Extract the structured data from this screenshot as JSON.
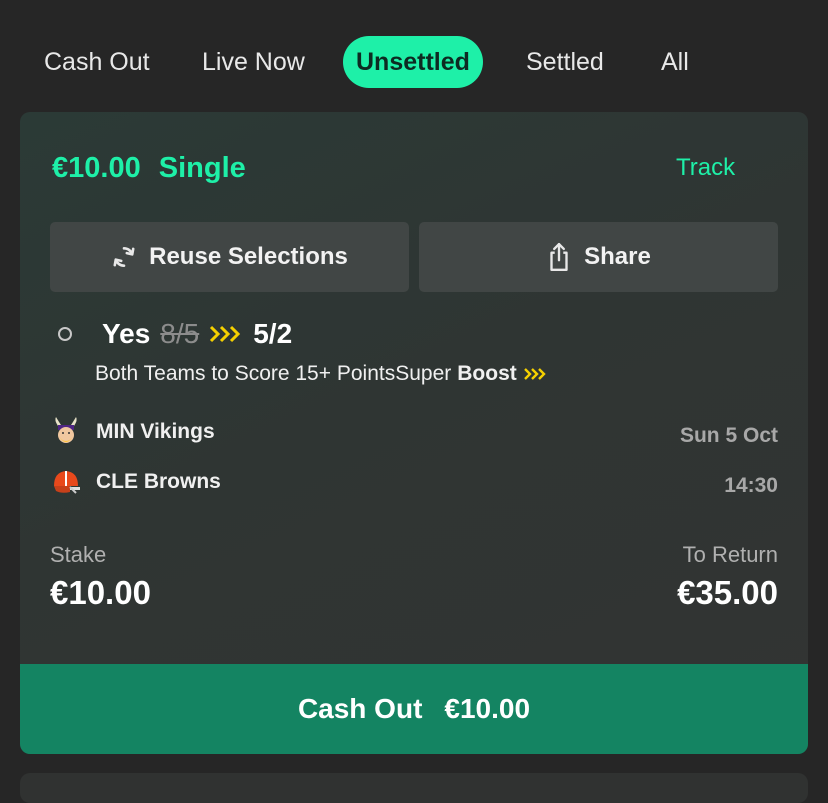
{
  "tabs": [
    {
      "label": "Cash Out",
      "active": false
    },
    {
      "label": "Live Now",
      "active": false
    },
    {
      "label": "Unsettled",
      "active": true
    },
    {
      "label": "Settled",
      "active": false
    },
    {
      "label": "All",
      "active": false
    }
  ],
  "bet": {
    "amount": "€10.00",
    "type": "Single",
    "track_label": "Track",
    "reuse_label": "Reuse Selections",
    "share_label": "Share",
    "selection": {
      "name": "Yes",
      "old_odds": "8/5",
      "new_odds": "5/2",
      "market": "Both Teams to Score 15+ PointsSuper",
      "boost_label": "Boost"
    },
    "teams": [
      {
        "name": "MIN Vikings",
        "logo": "vikings-logo"
      },
      {
        "name": "CLE Browns",
        "logo": "browns-logo"
      }
    ],
    "date": "Sun 5 Oct",
    "time": "14:30",
    "stake_label": "Stake",
    "stake_value": "€10.00",
    "return_label": "To Return",
    "return_value": "€35.00",
    "cashout_label": "Cash Out",
    "cashout_value": "€10.00"
  },
  "colors": {
    "accent": "#1ef0a8",
    "background": "#262626",
    "cashout": "#148462",
    "boost": "#f5d000"
  }
}
